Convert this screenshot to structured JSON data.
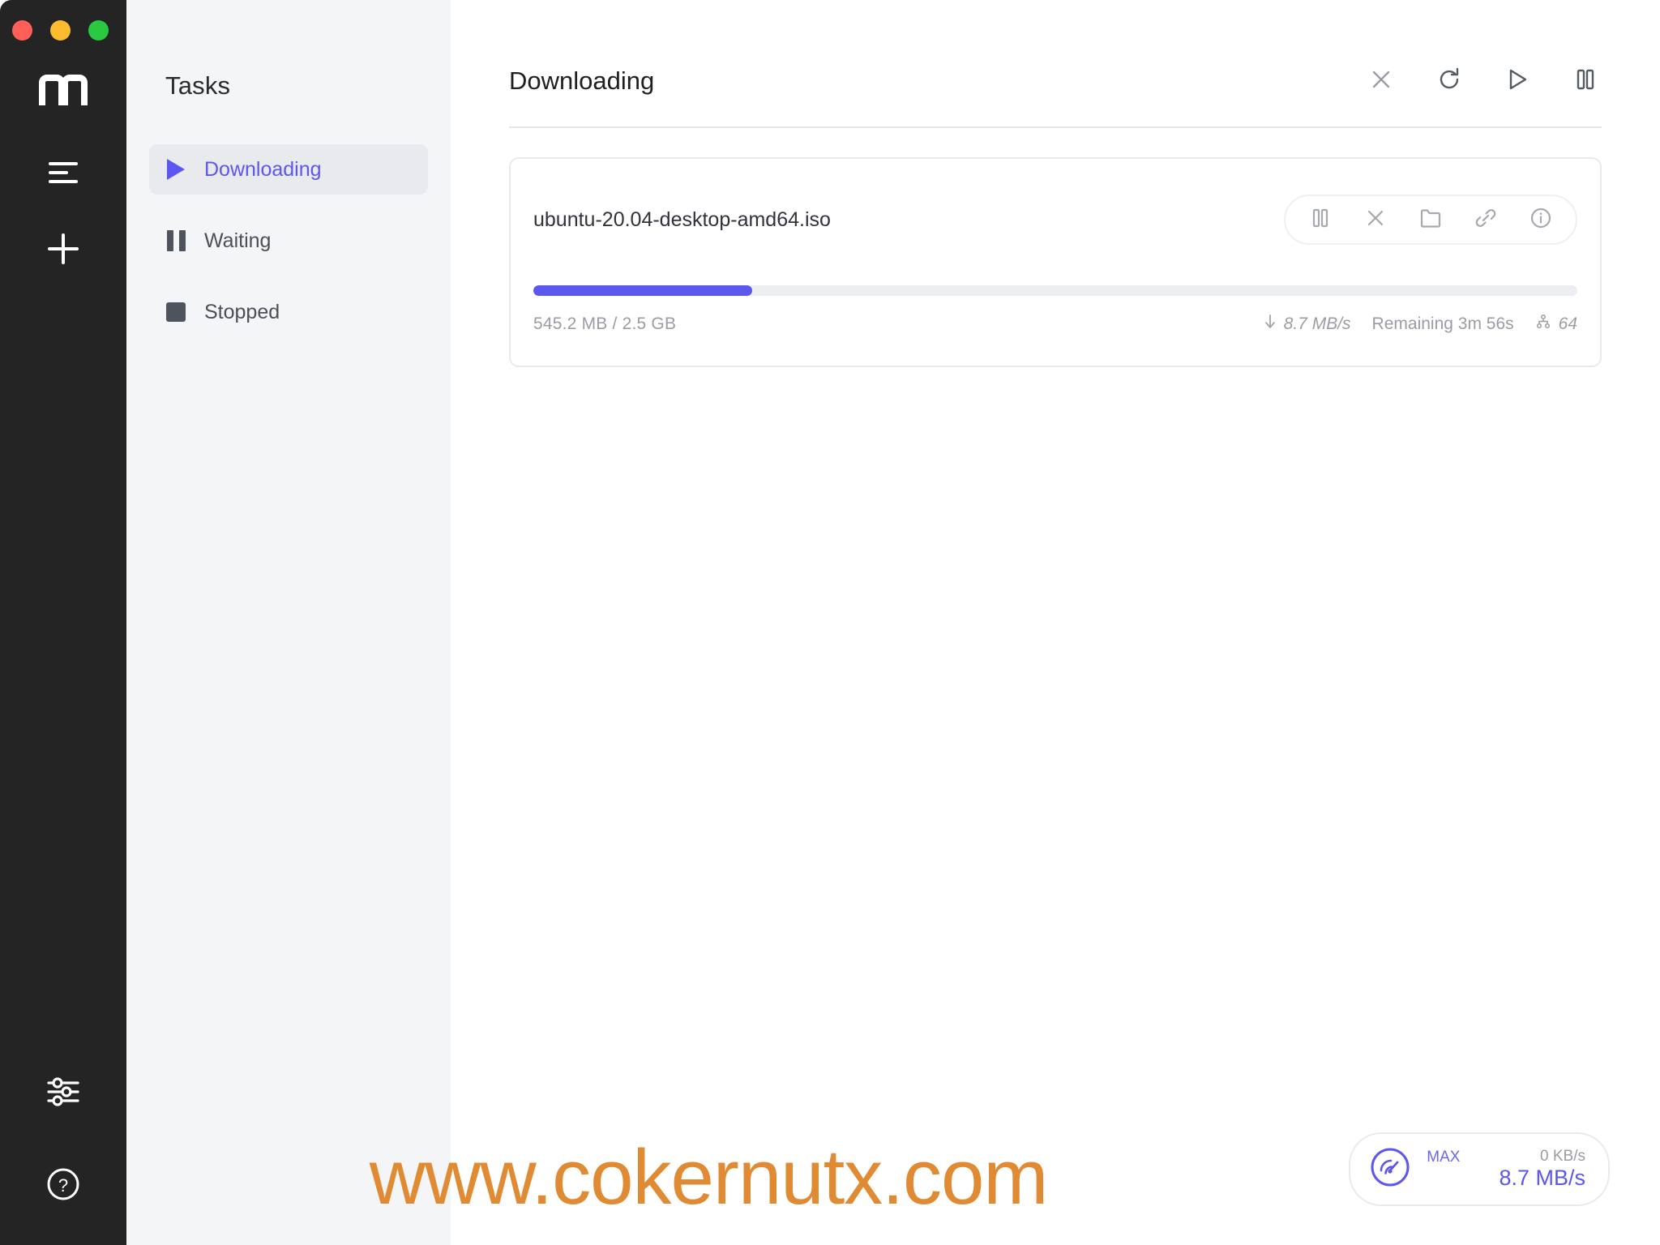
{
  "window": {
    "traffic_lights": [
      {
        "name": "close",
        "color": "#FF5F57"
      },
      {
        "name": "minimize",
        "color": "#FDBC2E"
      },
      {
        "name": "zoom",
        "color": "#2AC940"
      }
    ]
  },
  "rail": {
    "logo_label": "m",
    "buttons": [
      {
        "name": "menu-icon",
        "label": "Menu"
      },
      {
        "name": "add-icon",
        "label": "Add"
      }
    ],
    "bottom_buttons": [
      {
        "name": "settings-icon",
        "label": "Settings"
      },
      {
        "name": "help-icon",
        "label": "Help"
      }
    ]
  },
  "sidebar": {
    "title": "Tasks",
    "items": [
      {
        "label": "Downloading",
        "icon": "play-icon",
        "active": true
      },
      {
        "label": "Waiting",
        "icon": "pause-icon",
        "active": false
      },
      {
        "label": "Stopped",
        "icon": "stop-icon",
        "active": false
      }
    ]
  },
  "header": {
    "title": "Downloading",
    "actions": [
      {
        "name": "close-icon",
        "label": "Remove"
      },
      {
        "name": "refresh-icon",
        "label": "Refresh"
      },
      {
        "name": "play-icon",
        "label": "Resume"
      },
      {
        "name": "pause-icon",
        "label": "Pause"
      }
    ]
  },
  "task": {
    "filename": "ubuntu-20.04-desktop-amd64.iso",
    "progress_percent": 21,
    "downloaded": "545.2 MB / 2.5 GB",
    "speed": "8.7 MB/s",
    "remaining": "Remaining 3m 56s",
    "connections": "64",
    "actions": [
      {
        "name": "pause-icon",
        "label": "Pause"
      },
      {
        "name": "close-icon",
        "label": "Cancel"
      },
      {
        "name": "folder-icon",
        "label": "Open folder"
      },
      {
        "name": "link-icon",
        "label": "Copy link"
      },
      {
        "name": "info-icon",
        "label": "Details"
      }
    ]
  },
  "speed_widget": {
    "max_label": "MAX",
    "upload": "0 KB/s",
    "download": "8.7 MB/s"
  },
  "watermark": {
    "text": "www.cokernutx.com"
  },
  "colors": {
    "accent": "#5B57EC",
    "accent_light": "#6B68E8",
    "rail_bg": "#242424",
    "panel_bg": "#F4F5F7",
    "active_bg": "#E9EAEE",
    "muted_text": "#9A9DA4",
    "watermark": "#E08A34"
  }
}
